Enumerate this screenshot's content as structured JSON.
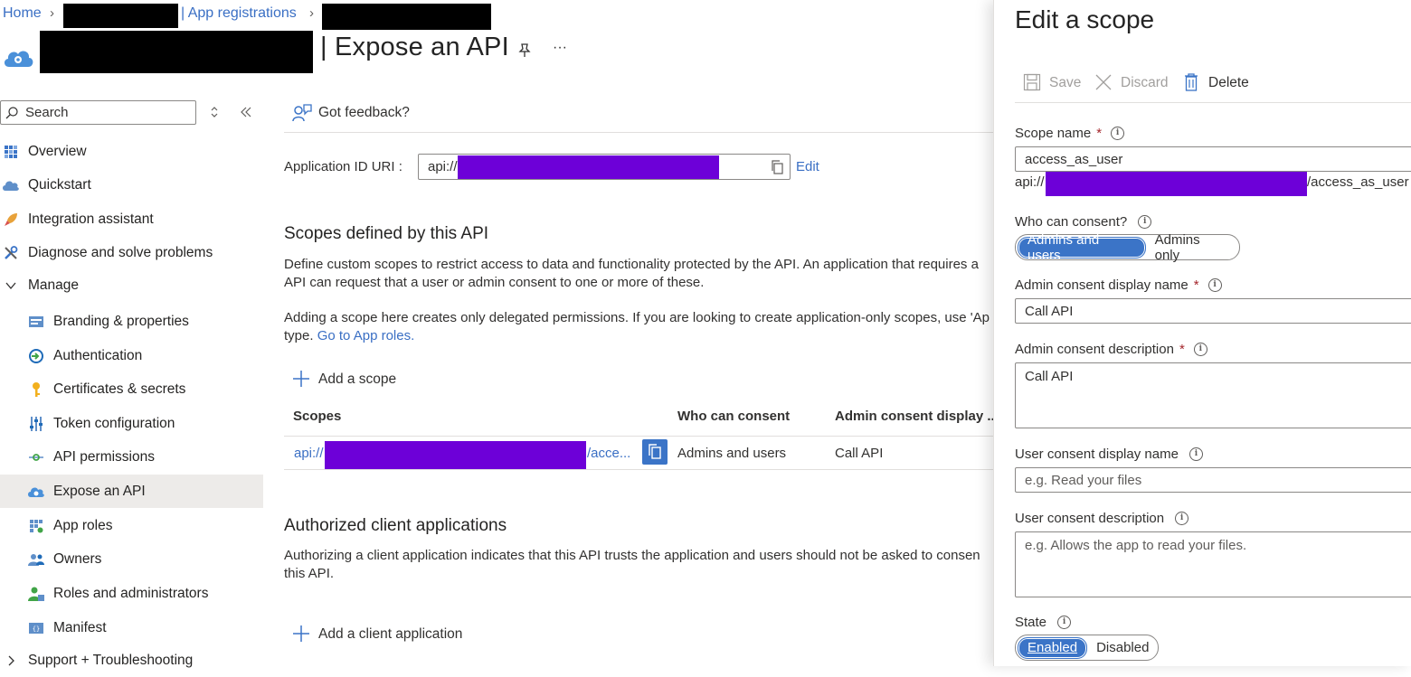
{
  "breadcrumb": {
    "home": "Home",
    "app_registrations": "| App registrations"
  },
  "page": {
    "title": "| Expose an API",
    "more": "···"
  },
  "sidebar": {
    "search_placeholder": "Search",
    "items": [
      {
        "label": "Overview",
        "icon": "grid-icon"
      },
      {
        "label": "Quickstart",
        "icon": "cloud-icon"
      },
      {
        "label": "Integration assistant",
        "icon": "rocket-icon"
      },
      {
        "label": "Diagnose and solve problems",
        "icon": "wrench-icon"
      },
      {
        "label": "Manage",
        "icon": "chevron-down-icon"
      },
      {
        "label": "Branding & properties",
        "icon": "branding-icon"
      },
      {
        "label": "Authentication",
        "icon": "authentication-icon"
      },
      {
        "label": "Certificates & secrets",
        "icon": "key-icon"
      },
      {
        "label": "Token configuration",
        "icon": "token-icon"
      },
      {
        "label": "API permissions",
        "icon": "api-permissions-icon"
      },
      {
        "label": "Expose an API",
        "icon": "cloud-gear-icon"
      },
      {
        "label": "App roles",
        "icon": "app-roles-icon"
      },
      {
        "label": "Owners",
        "icon": "owners-icon"
      },
      {
        "label": "Roles and administrators",
        "icon": "roles-icon"
      },
      {
        "label": "Manifest",
        "icon": "manifest-icon"
      },
      {
        "label": "Support + Troubleshooting",
        "icon": "chevron-right-icon"
      }
    ]
  },
  "main": {
    "feedback": "Got feedback?",
    "app_id_label": "Application ID URI :",
    "app_id_prefix": "api://",
    "edit": "Edit",
    "scopes_title": "Scopes defined by this API",
    "scopes_desc_1": "Define custom scopes to restrict access to data and functionality protected by the API. An application that requires a",
    "scopes_desc_2": "API can request that a user or admin consent to one or more of these.",
    "scopes_desc_3": "Adding a scope here creates only delegated permissions. If you are looking to create application-only scopes, use 'Ap",
    "scopes_desc_4_prefix": "type.",
    "go_to_app_roles": "Go to App roles.",
    "add_scope": "Add a scope",
    "table": {
      "headers": [
        "Scopes",
        "Who can consent",
        "Admin consent display ..."
      ],
      "row": {
        "scope_prefix": "api://",
        "scope_suffix": "/acce...",
        "who": "Admins and users",
        "display": "Call API"
      }
    },
    "clients_title": "Authorized client applications",
    "clients_desc_1": "Authorizing a client application indicates that this API trusts the application and users should not be asked to consen",
    "clients_desc_2": "this API.",
    "add_client": "Add a client application"
  },
  "panel": {
    "title": "Edit a scope",
    "save": "Save",
    "discard": "Discard",
    "delete": "Delete",
    "scope_name_label": "Scope name",
    "scope_name_value": "access_as_user",
    "scope_uri_prefix": "api://",
    "scope_uri_suffix": "/access_as_user",
    "who_label": "Who can consent?",
    "who_options": [
      "Admins and users",
      "Admins only"
    ],
    "admin_display_label": "Admin consent display name",
    "admin_display_value": "Call API",
    "admin_desc_label": "Admin consent description",
    "admin_desc_value": "Call API",
    "user_display_label": "User consent display name",
    "user_display_placeholder": "e.g. Read your files",
    "user_desc_label": "User consent description",
    "user_desc_placeholder": "e.g. Allows the app to read your files.",
    "state_label": "State",
    "state_options": [
      "Enabled",
      "Disabled"
    ]
  },
  "colors": {
    "link": "#3a6fc4",
    "toggle_selected": "#3b74c7",
    "redaction_purple": "#6d00d8",
    "active_nav": "#edebe9"
  }
}
